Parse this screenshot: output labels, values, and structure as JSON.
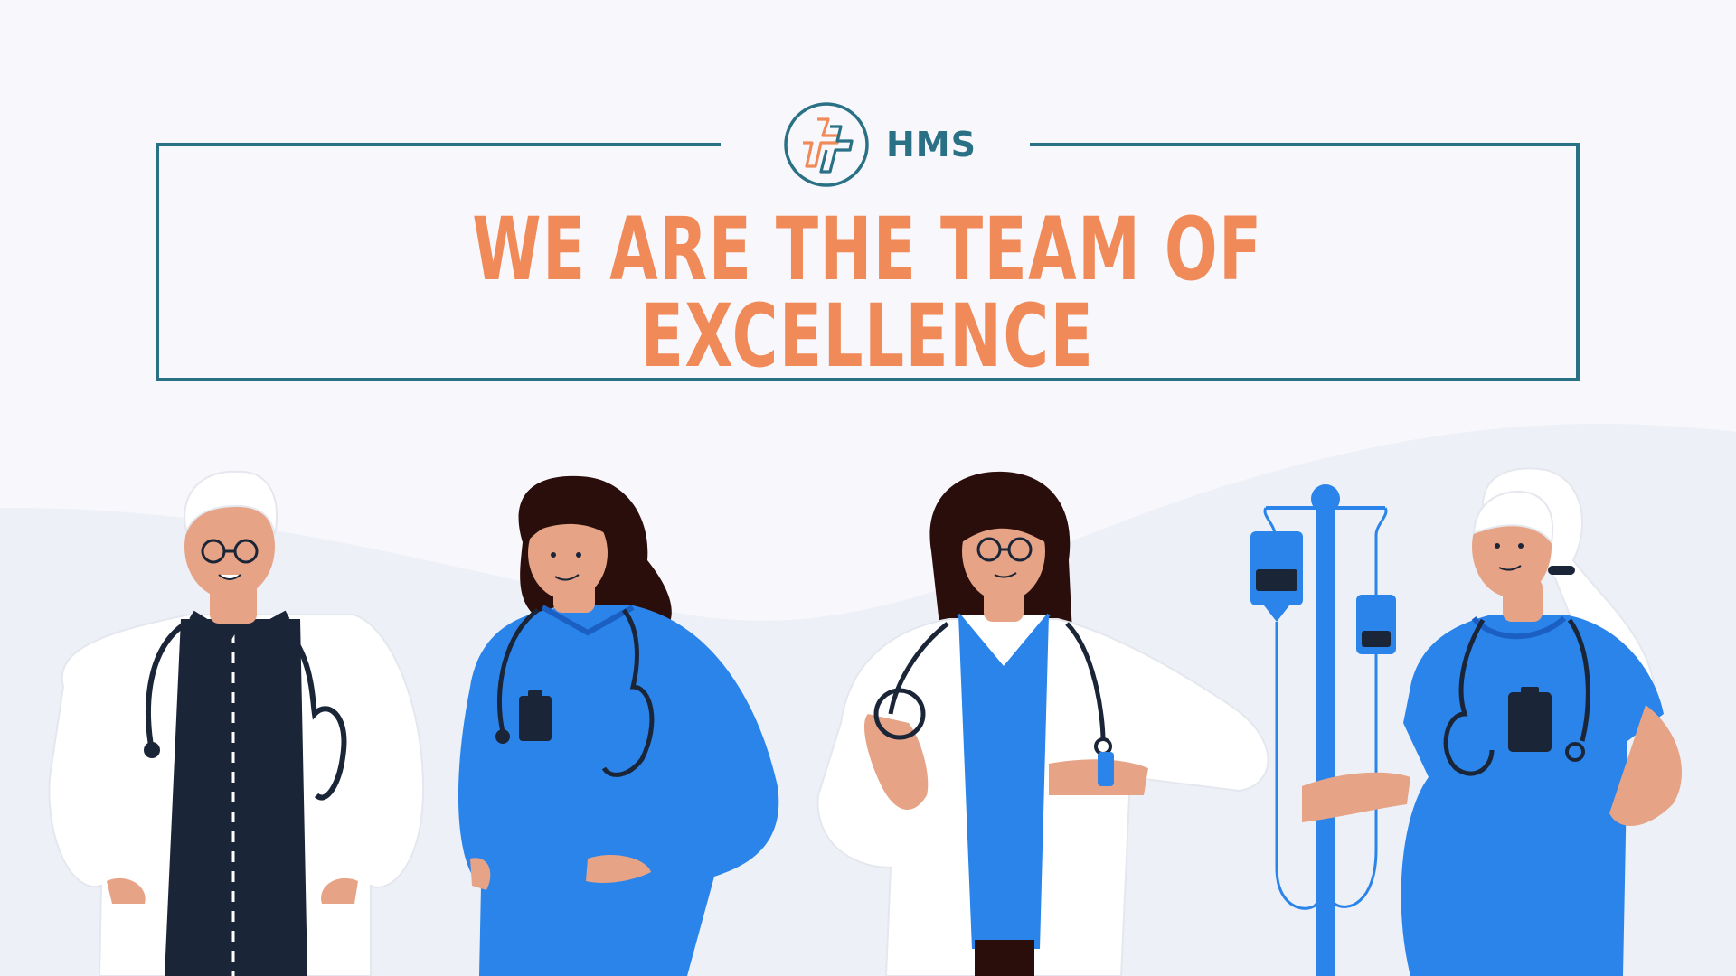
{
  "brand": {
    "logo_text": "HMS",
    "logo_icon": "medical-cross-icon"
  },
  "headline": "WE ARE THE TEAM OF EXCELLENCE",
  "colors": {
    "background": "#f7f7fc",
    "wave": "#edf0f7",
    "frame": "#2a7186",
    "headline": "#f08a58",
    "scrubs": "#2a84ea",
    "skin": "#e6a386",
    "coat": "#ffffff",
    "dark": "#1b2538"
  },
  "illustration": {
    "figures": [
      "doctor-elderly-man",
      "nurse-woman-hands-on-hips",
      "doctor-woman-checking-watch",
      "nurse-elderly-woman-with-iv-stand"
    ]
  }
}
